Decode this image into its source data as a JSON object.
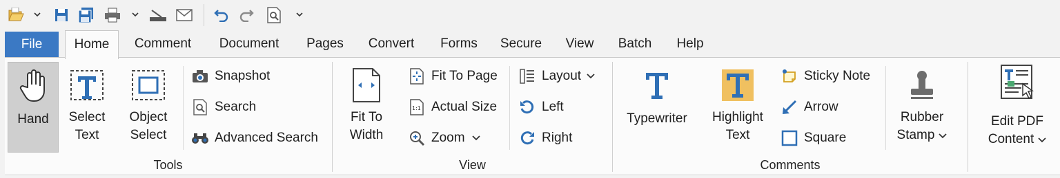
{
  "quick_access": {
    "icons": [
      "open-folder-icon",
      "save-icon",
      "save-all-icon",
      "print-icon",
      "scanner-icon",
      "email-icon",
      "undo-icon",
      "redo-icon",
      "find-icon"
    ]
  },
  "tabs": [
    "File",
    "Home",
    "Comment",
    "Document",
    "Pages",
    "Convert",
    "Forms",
    "Secure",
    "View",
    "Batch",
    "Help"
  ],
  "active_tab": "Home",
  "groups": {
    "tools": {
      "label": "Tools",
      "hand": "Hand",
      "select_text_1": "Select",
      "select_text_2": "Text",
      "object_select_1": "Object",
      "object_select_2": "Select",
      "snapshot": "Snapshot",
      "search": "Search",
      "advanced_search": "Advanced Search"
    },
    "view": {
      "label": "View",
      "fit_to_width_1": "Fit To",
      "fit_to_width_2": "Width",
      "fit_to_page": "Fit To Page",
      "actual_size": "Actual Size",
      "zoom": "Zoom",
      "layout": "Layout",
      "left": "Left",
      "right": "Right"
    },
    "comments": {
      "label": "Comments",
      "typewriter": "Typewriter",
      "highlight_text_1": "Highlight",
      "highlight_text_2": "Text",
      "sticky_note": "Sticky Note",
      "arrow": "Arrow",
      "square": "Square",
      "rubber_stamp_1": "Rubber",
      "rubber_stamp_2": "Stamp"
    },
    "edit": {
      "edit_pdf_1": "Edit PDF",
      "edit_pdf_2": "Content"
    }
  },
  "colors": {
    "file_tab": "#3b79c4",
    "icon_blue": "#2f6fb5",
    "highlight": "#f0c060"
  }
}
